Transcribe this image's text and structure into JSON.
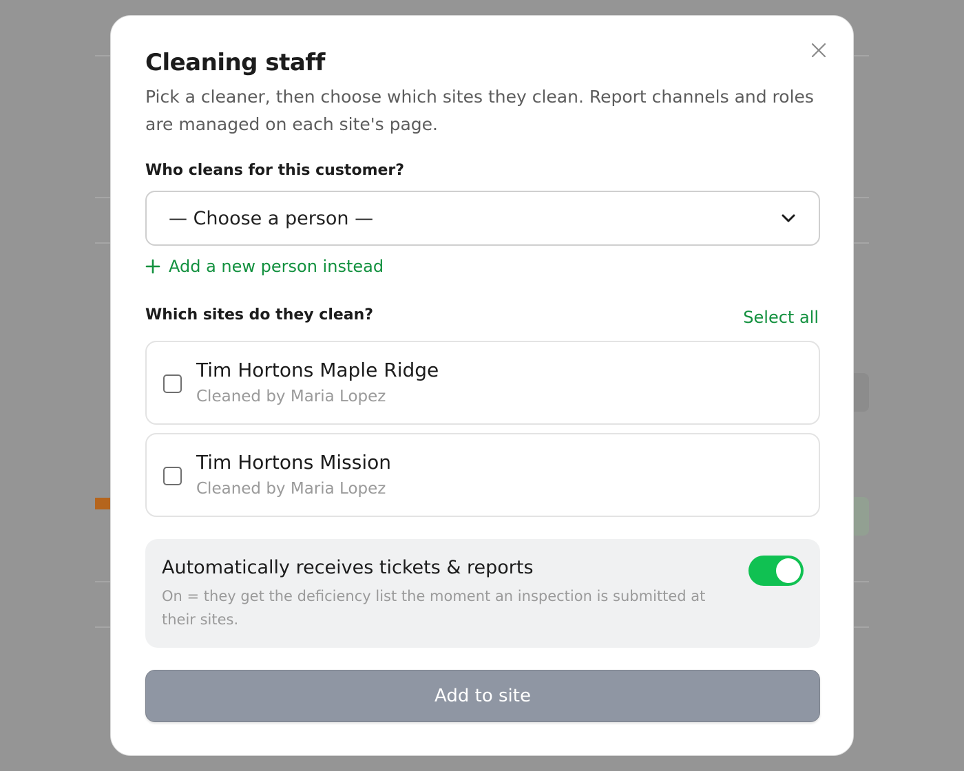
{
  "modal": {
    "title": "Cleaning staff",
    "subtitle": "Pick a cleaner, then choose which sites they clean. Report channels and roles are managed on each site's page."
  },
  "person": {
    "label": "Who cleans for this customer?",
    "select_value": "— Choose a person —",
    "add_new_label": "Add a new person instead"
  },
  "sites": {
    "label": "Which sites do they clean?",
    "select_all_label": "Select all",
    "items": [
      {
        "name": "Tim Hortons Maple Ridge",
        "sub": "Cleaned by Maria Lopez",
        "checked": false
      },
      {
        "name": "Tim Hortons Mission",
        "sub": "Cleaned by Maria Lopez",
        "checked": false
      }
    ]
  },
  "auto": {
    "title": "Automatically receives tickets & reports",
    "description": "On = they get the deficiency list the moment an inspection is submitted at their sites.",
    "enabled": true
  },
  "submit": {
    "label": "Add to site"
  },
  "colors": {
    "accent": "#13913f",
    "toggle_on": "#10c152",
    "button_disabled": "#8f96a3",
    "overlay": "#959595"
  }
}
